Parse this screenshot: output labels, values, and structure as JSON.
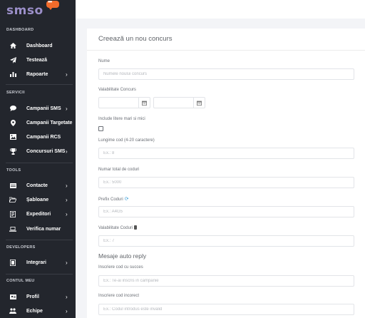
{
  "brand": {
    "logo_text": "smso"
  },
  "sidebar": {
    "sections": [
      {
        "title": "DASHBOARD"
      },
      {
        "title": "SERVICII"
      },
      {
        "title": "TOOLS"
      },
      {
        "title": "DEVELOPERS"
      },
      {
        "title": "CONTUL MEU"
      }
    ],
    "items": [
      {
        "label": "Dashboard",
        "icon": "home-icon",
        "chevron": ""
      },
      {
        "label": "Testează",
        "icon": "paper-plane-icon",
        "chevron": ""
      },
      {
        "label": "Rapoarte",
        "icon": "bar-chart-icon",
        "chevron": "›"
      },
      {
        "label": "Campanii SMS",
        "icon": "chat-bubble-icon",
        "chevron": "›"
      },
      {
        "label": "Campanii Targetate",
        "icon": "map-pin-icon",
        "chevron": ""
      },
      {
        "label": "Campanii RCS",
        "icon": "image-icon",
        "chevron": ""
      },
      {
        "label": "Concursuri SMS",
        "icon": "trophy-icon",
        "chevron": "›"
      },
      {
        "label": "Contacte",
        "icon": "address-card-icon",
        "chevron": "›"
      },
      {
        "label": "Șabloane",
        "icon": "folder-open-icon",
        "chevron": "›"
      },
      {
        "label": "Expeditori",
        "icon": "sender-id-icon",
        "chevron": "›"
      },
      {
        "label": "Verifica numar",
        "icon": "laptop-icon",
        "chevron": ""
      },
      {
        "label": "Integrari",
        "icon": "integration-icon",
        "chevron": "›"
      },
      {
        "label": "Profil",
        "icon": "profile-card-icon",
        "chevron": "›"
      },
      {
        "label": "Echipe",
        "icon": "team-icon",
        "chevron": "›"
      }
    ]
  },
  "form": {
    "title": "Creează un nou concurs",
    "nume": {
      "label": "Nume",
      "placeholder": "Numele noului concurs"
    },
    "valabilitate": {
      "label": "Valabilitate Concurs",
      "start_value": "",
      "end_value": ""
    },
    "include": {
      "label": "Include litere mari si mici",
      "checked": false
    },
    "lungime": {
      "label": "Lungime cod (4-20 caractere)",
      "placeholder": "Ex.: 8"
    },
    "numar": {
      "label": "Numar total de coduri",
      "placeholder": "Ex.: 5000"
    },
    "prefix": {
      "label": "Prefix Coduri",
      "placeholder": "Ex.: A4G5"
    },
    "valabilitate_coduri": {
      "label": "Valabilitate Coduri",
      "placeholder": "Ex.: 7"
    },
    "auto_reply_heading": "Mesaje auto reply",
    "succes": {
      "label": "Inscriere cod cu succes",
      "placeholder": "Ex.: Te-ai inscris in campanie"
    },
    "incorect": {
      "label": "Inscriere cod incorect",
      "placeholder": "Ex.: Codul introdus este invalid"
    }
  },
  "colors": {
    "sidebar_bg": "#23262d",
    "logo": "#9b8fc9",
    "logo_badge": "#f26b2b",
    "refresh_icon": "#3fa0d8"
  }
}
